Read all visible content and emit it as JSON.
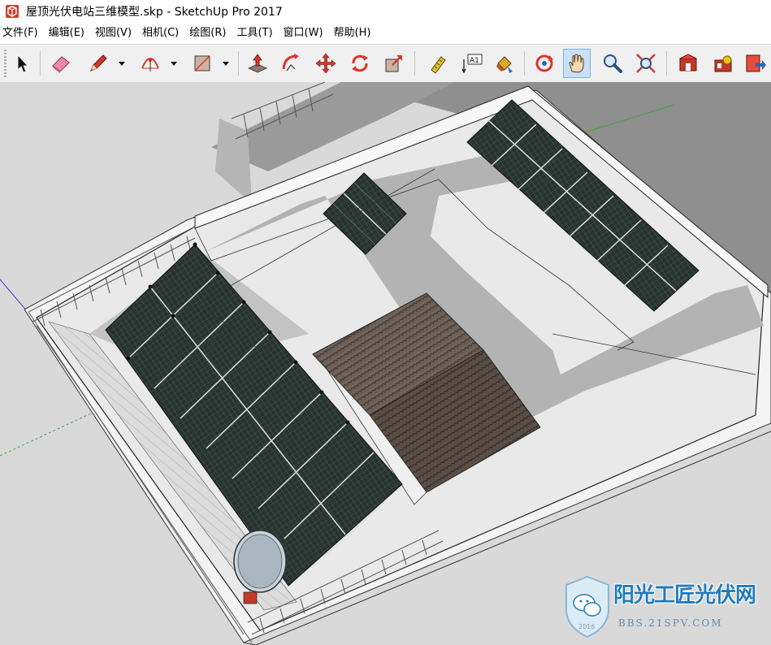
{
  "window": {
    "title": "屋顶光伏电站三维模型.skp - SketchUp Pro 2017"
  },
  "menu": [
    {
      "label": "文件(F)"
    },
    {
      "label": "编辑(E)"
    },
    {
      "label": "视图(V)"
    },
    {
      "label": "相机(C)"
    },
    {
      "label": "绘图(R)"
    },
    {
      "label": "工具(T)"
    },
    {
      "label": "窗口(W)"
    },
    {
      "label": "帮助(H)"
    }
  ],
  "toolbar": {
    "tools": [
      {
        "name": "select-tool",
        "icon": "arrow-cursor-icon"
      },
      {
        "name": "eraser-tool",
        "icon": "eraser-icon"
      },
      {
        "name": "line-tool",
        "icon": "pencil-icon",
        "dropdown": true
      },
      {
        "name": "arc-tool",
        "icon": "arc-icon",
        "dropdown": true
      },
      {
        "name": "rectangle-tool",
        "icon": "rectangle-icon",
        "dropdown": true
      },
      {
        "name": "push-pull-tool",
        "icon": "push-pull-icon"
      },
      {
        "name": "follow-me-tool",
        "icon": "follow-me-icon"
      },
      {
        "name": "move-tool",
        "icon": "move-icon"
      },
      {
        "name": "rotate-tool",
        "icon": "rotate-icon"
      },
      {
        "name": "scale-tool",
        "icon": "scale-icon"
      },
      {
        "name": "tape-measure-tool",
        "icon": "tape-measure-icon"
      },
      {
        "name": "text-tool",
        "icon": "text-label-icon",
        "label": "A1"
      },
      {
        "name": "paint-bucket-tool",
        "icon": "paint-bucket-icon"
      },
      {
        "name": "orbit-tool",
        "icon": "orbit-icon"
      },
      {
        "name": "pan-tool",
        "icon": "hand-icon",
        "active": true
      },
      {
        "name": "zoom-tool",
        "icon": "magnifier-icon"
      },
      {
        "name": "zoom-extents-tool",
        "icon": "zoom-extents-icon"
      },
      {
        "name": "3d-warehouse-tool",
        "icon": "warehouse-icon"
      },
      {
        "name": "extension-warehouse-tool",
        "icon": "extension-icon"
      },
      {
        "name": "layout-send-tool",
        "icon": "send-to-layout-icon"
      }
    ]
  },
  "colors": {
    "panel_fill": "#27332f",
    "panel_grid": "#b8c6c0",
    "roof_tile": "#6b5e55",
    "roof_surface": "#e6e6e6",
    "shadow": "#a9a9a9",
    "ground": "#d9d9d9",
    "wall": "#f2f2f2",
    "accent_blue": "#1f7bbd"
  },
  "watermark": {
    "title": "阳光工匠光伏网",
    "url": "BBS.21SPV.COM",
    "year": "2016"
  }
}
